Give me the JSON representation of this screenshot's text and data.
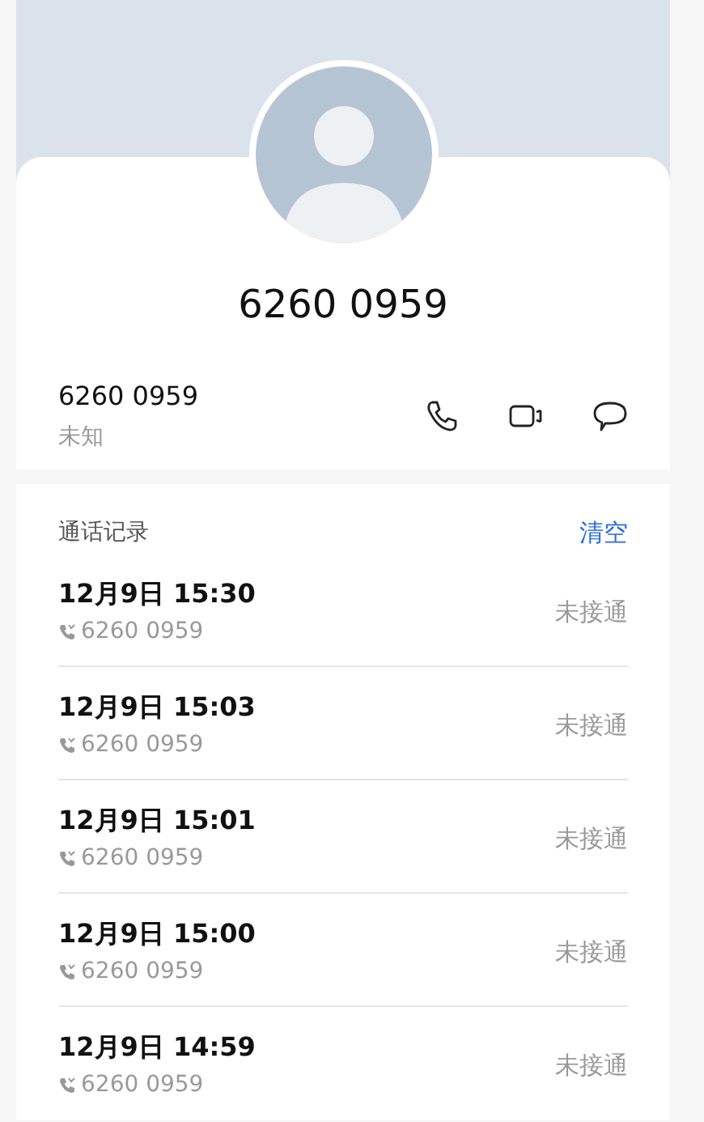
{
  "contact": {
    "title": "6260 0959",
    "number": "6260 0959",
    "label": "未知"
  },
  "actions": [
    {
      "kind": "call"
    },
    {
      "kind": "video"
    },
    {
      "kind": "message"
    }
  ],
  "history": {
    "title": "通话记录",
    "clear": "清空",
    "calls": [
      {
        "time": "12月9日 15:30",
        "number": "6260 0959",
        "status": "未接通"
      },
      {
        "time": "12月9日 15:03",
        "number": "6260 0959",
        "status": "未接通"
      },
      {
        "time": "12月9日 15:01",
        "number": "6260 0959",
        "status": "未接通"
      },
      {
        "time": "12月9日 15:00",
        "number": "6260 0959",
        "status": "未接通"
      },
      {
        "time": "12月9日 14:59",
        "number": "6260 0959",
        "status": "未接通"
      }
    ]
  }
}
